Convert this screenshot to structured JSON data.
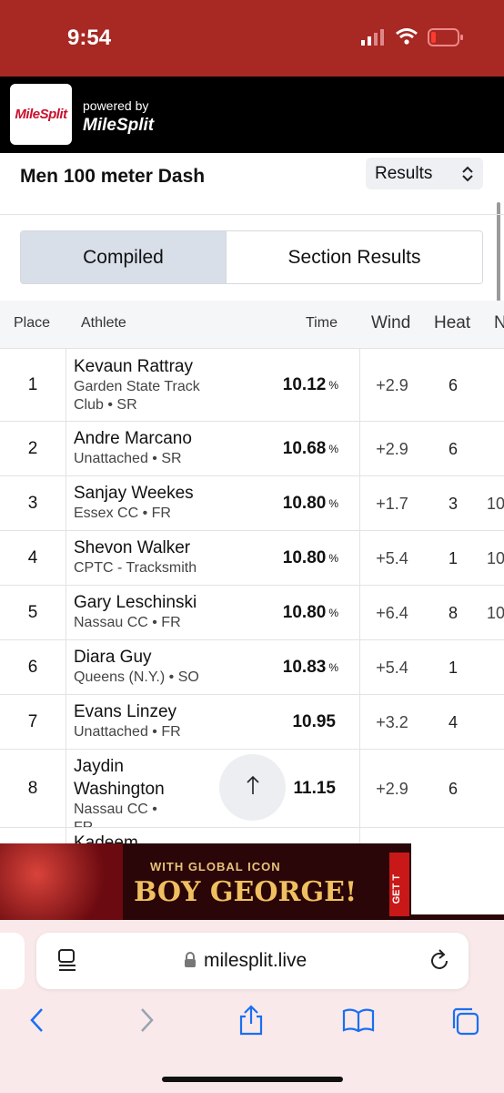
{
  "status": {
    "time": "9:54"
  },
  "header": {
    "logo_text": "MileSplit",
    "powered_by": "powered by",
    "brand": "MileSplit"
  },
  "event": {
    "title": "Men 100 meter Dash",
    "results_select": "Results"
  },
  "tabs": [
    {
      "label": "Compiled",
      "selected": true
    },
    {
      "label": "Section Results",
      "selected": false
    }
  ],
  "table": {
    "headers": {
      "place": "Place",
      "athlete": "Athlete",
      "time": "Time",
      "wind": "Wind",
      "heat": "Heat",
      "extra": "N"
    },
    "rows": [
      {
        "place": "1",
        "name": "Kevaun Rattray",
        "sub": "Garden State Track Club • SR",
        "time": "10.12",
        "pct": "%",
        "wind": "+2.9",
        "heat": "6",
        "extra": ""
      },
      {
        "place": "2",
        "name": "Andre Marcano",
        "sub": "Unattached • SR",
        "time": "10.68",
        "pct": "%",
        "wind": "+2.9",
        "heat": "6",
        "extra": ""
      },
      {
        "place": "3",
        "name": "Sanjay Weekes",
        "sub": "Essex CC • FR",
        "time": "10.80",
        "pct": "%",
        "wind": "+1.7",
        "heat": "3",
        "extra": "10"
      },
      {
        "place": "4",
        "name": "Shevon Walker",
        "sub": "CPTC - Tracksmith",
        "time": "10.80",
        "pct": "%",
        "wind": "+5.4",
        "heat": "1",
        "extra": "10"
      },
      {
        "place": "5",
        "name": "Gary Leschinski",
        "sub": "Nassau CC • FR",
        "time": "10.80",
        "pct": "%",
        "wind": "+6.4",
        "heat": "8",
        "extra": "10"
      },
      {
        "place": "6",
        "name": "Diara Guy",
        "sub": "Queens (N.Y.) • SO",
        "time": "10.83",
        "pct": "%",
        "wind": "+5.4",
        "heat": "1",
        "extra": ""
      },
      {
        "place": "7",
        "name": "Evans Linzey",
        "sub": "Unattached • FR",
        "time": "10.95",
        "pct": "",
        "wind": "+3.2",
        "heat": "4",
        "extra": ""
      },
      {
        "place": "8",
        "name": "Jaydin Washington",
        "sub": "Nassau CC • FR",
        "time": "11.15",
        "pct": "",
        "wind": "+2.9",
        "heat": "6",
        "extra": ""
      },
      {
        "place": "",
        "name": "Kadeem",
        "sub": "",
        "time": "",
        "pct": "",
        "wind": "",
        "heat": "",
        "extra": ""
      }
    ]
  },
  "ad": {
    "line1": "WITH GLOBAL ICON",
    "line2": "BOY GEORGE!",
    "cta": "GET T"
  },
  "browser": {
    "url": "milesplit.live"
  },
  "colors": {
    "status_bar": "#a82823",
    "tab_selected": "#d8dfe9",
    "browser_bg": "#f9e9ea",
    "link_blue": "#1a6ff2"
  }
}
